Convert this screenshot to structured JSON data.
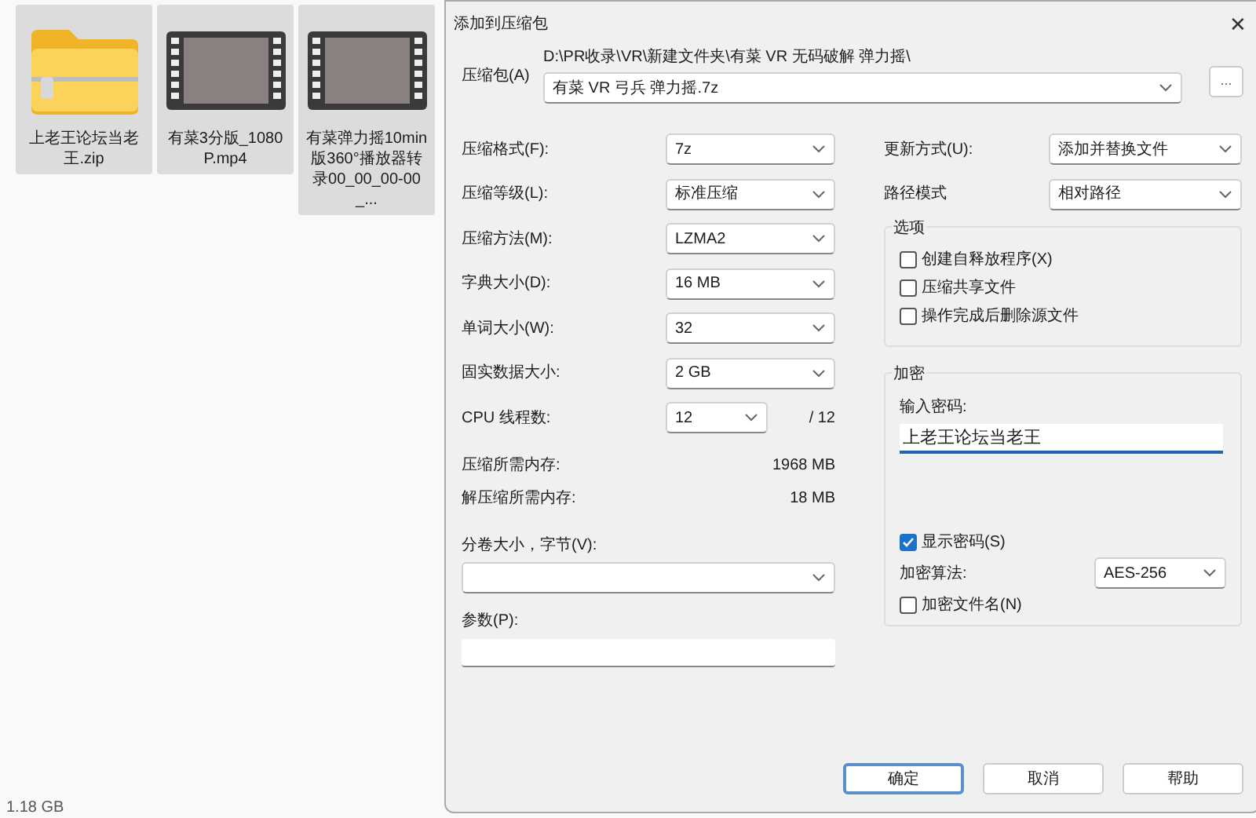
{
  "files": [
    {
      "name": "上老王论坛当老王.zip",
      "kind": "zip"
    },
    {
      "name": "有菜3分版_1080P.mp4",
      "kind": "video"
    },
    {
      "name": "有菜弹力摇10min版360°播放器转录00_00_00-00_...",
      "kind": "video"
    }
  ],
  "status_text": "1.18 GB",
  "dialog": {
    "title": "添加到压缩包",
    "close": "✕",
    "archive": {
      "label": "压缩包(A)",
      "path": "D:\\PR收录\\VR\\新建文件夹\\有菜 VR 无码破解 弹力摇\\",
      "value": "有菜 VR 弓兵 弹力摇.7z",
      "browse": "..."
    },
    "left_fields": [
      {
        "label": "压缩格式(F):",
        "value": "7z"
      },
      {
        "label": "压缩等级(L):",
        "value": "标准压缩"
      },
      {
        "label": "压缩方法(M):",
        "value": "LZMA2"
      },
      {
        "label": "字典大小(D):",
        "value": "16 MB"
      },
      {
        "label": "单词大小(W):",
        "value": "32"
      },
      {
        "label": "固实数据大小:",
        "value": "2 GB"
      }
    ],
    "cpu": {
      "label": "CPU 线程数:",
      "value": "12",
      "total": "/ 12"
    },
    "memory": [
      {
        "label": "压缩所需内存:",
        "value": "1968 MB"
      },
      {
        "label": "解压缩所需内存:",
        "value": "18 MB"
      }
    ],
    "split": {
      "label": "分卷大小，字节(V):"
    },
    "params": {
      "label": "参数(P):"
    },
    "right_fields": [
      {
        "label": "更新方式(U):",
        "value": "添加并替换文件"
      },
      {
        "label": "路径模式",
        "value": "相对路径"
      }
    ],
    "options": {
      "title": "选项",
      "items": [
        {
          "label": "创建自释放程序(X)",
          "checked": false
        },
        {
          "label": "压缩共享文件",
          "checked": false
        },
        {
          "label": "操作完成后删除源文件",
          "checked": false
        }
      ]
    },
    "encryption": {
      "title": "加密",
      "password_label": "输入密码:",
      "password": "上老王论坛当老王",
      "show_password": {
        "label": "显示密码(S)",
        "checked": true
      },
      "method": {
        "label": "加密算法:",
        "value": "AES-256"
      },
      "encrypt_names": {
        "label": "加密文件名(N)",
        "checked": false
      }
    },
    "buttons": [
      {
        "label": "确定",
        "default": true
      },
      {
        "label": "取消",
        "default": false
      },
      {
        "label": "帮助",
        "default": false
      }
    ]
  }
}
